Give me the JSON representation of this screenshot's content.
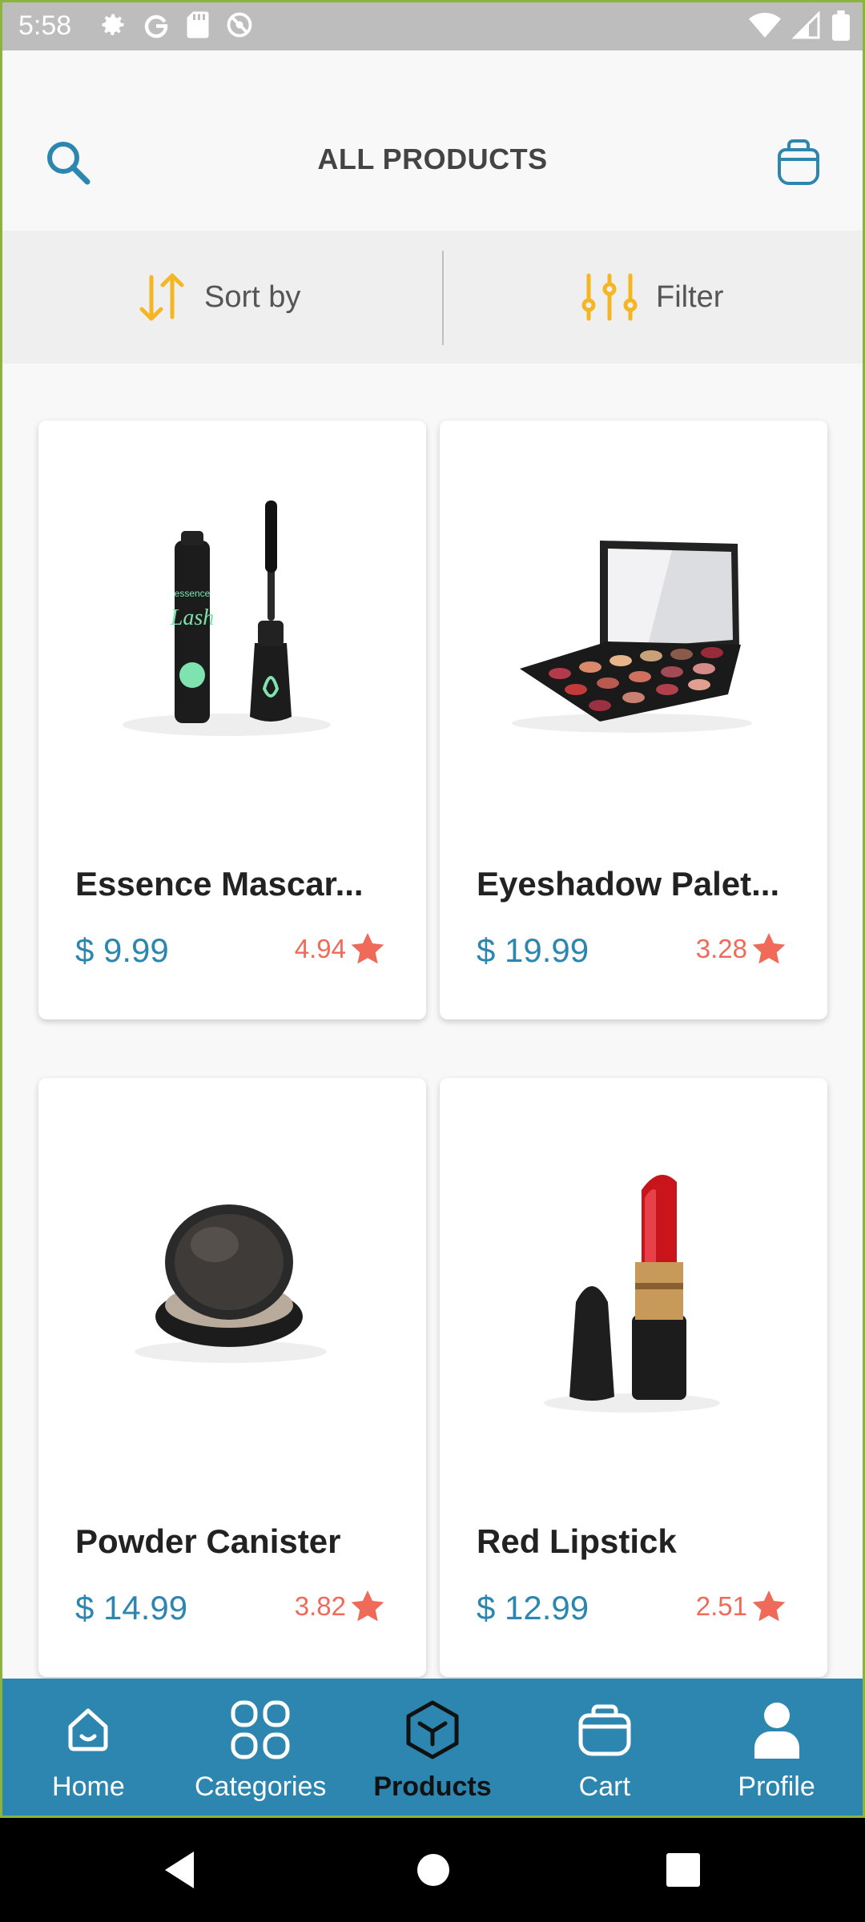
{
  "status_bar": {
    "time": "5:58"
  },
  "app_bar": {
    "title": "ALL PRODUCTS"
  },
  "sort_bar": {
    "sort_label": "Sort by",
    "filter_label": "Filter"
  },
  "colors": {
    "accent": "#2c86b0",
    "star": "#f06a5a",
    "sort_icon": "#f5b623"
  },
  "products": [
    {
      "name": "Essence Mascar...",
      "price": "$ 9.99",
      "rating": "4.94",
      "image": "mascara"
    },
    {
      "name": "Eyeshadow Palet...",
      "price": "$ 19.99",
      "rating": "3.28",
      "image": "eyeshadow-palette"
    },
    {
      "name": "Powder Canister",
      "price": "$ 14.99",
      "rating": "3.82",
      "image": "powder-canister"
    },
    {
      "name": "Red Lipstick",
      "price": "$ 12.99",
      "rating": "2.51",
      "image": "red-lipstick"
    }
  ],
  "bottom_nav": {
    "items": [
      {
        "label": "Home",
        "icon": "home-icon"
      },
      {
        "label": "Categories",
        "icon": "categories-icon"
      },
      {
        "label": "Products",
        "icon": "products-icon",
        "active": true
      },
      {
        "label": "Cart",
        "icon": "cart-icon"
      },
      {
        "label": "Profile",
        "icon": "profile-icon"
      }
    ]
  }
}
